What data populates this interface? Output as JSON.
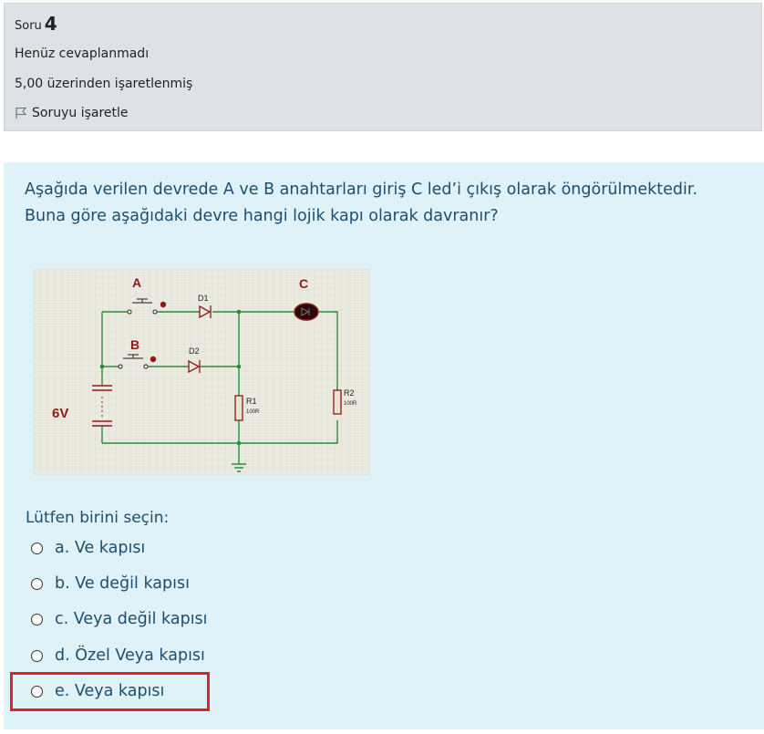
{
  "question_info": {
    "label": "Soru",
    "number": "4",
    "state": "Henüz cevaplanmadı",
    "grade": "5,00 üzerinden işaretlenmiş",
    "flag_label": "Soruyu işaretle"
  },
  "question": {
    "line1": "Aşağıda verilen devrede A ve B anahtarları giriş C led’i çıkış olarak öngörülmektedir.",
    "line2": "Buna göre aşağıdaki devre hangi lojik kapı olarak davranır?"
  },
  "circuit": {
    "switch_a": "A",
    "switch_b": "B",
    "led": "C",
    "diode1": "D1",
    "diode2": "D2",
    "resistor1": "R1",
    "resistor1_value": "100R",
    "resistor2": "R2",
    "resistor2_value": "100R",
    "battery": "6V"
  },
  "answer": {
    "prompt": "Lütfen birini seçin:",
    "options": [
      {
        "label": "a. Ve kapısı"
      },
      {
        "label": "b. Ve değil kapısı"
      },
      {
        "label": "c. Veya değil kapısı"
      },
      {
        "label": "d. Özel Veya kapısı"
      },
      {
        "label": "e. Veya kapısı"
      }
    ]
  },
  "colors": {
    "info_bg": "#dee2e6",
    "content_bg": "#def2f8",
    "text": "#1f4e6b",
    "highlight": "#d9232e",
    "wire": "#2e8b3a",
    "component": "#8b1a1a"
  }
}
